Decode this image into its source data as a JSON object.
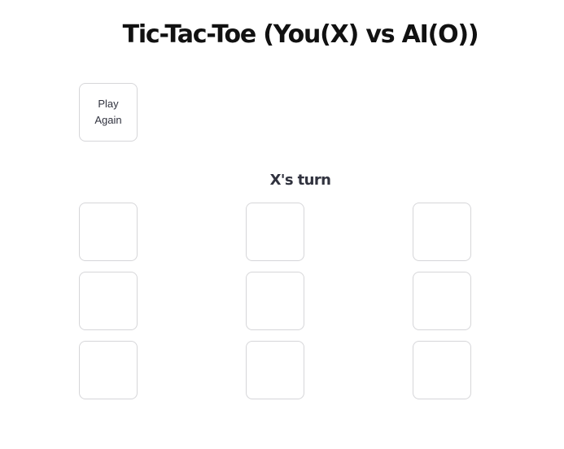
{
  "title": "Tic-Tac-Toe (You(X) vs AI(O))",
  "play_again_label": "Play Again",
  "status": "X's turn",
  "board": [
    [
      "",
      "",
      ""
    ],
    [
      "",
      "",
      ""
    ],
    [
      "",
      "",
      ""
    ]
  ]
}
